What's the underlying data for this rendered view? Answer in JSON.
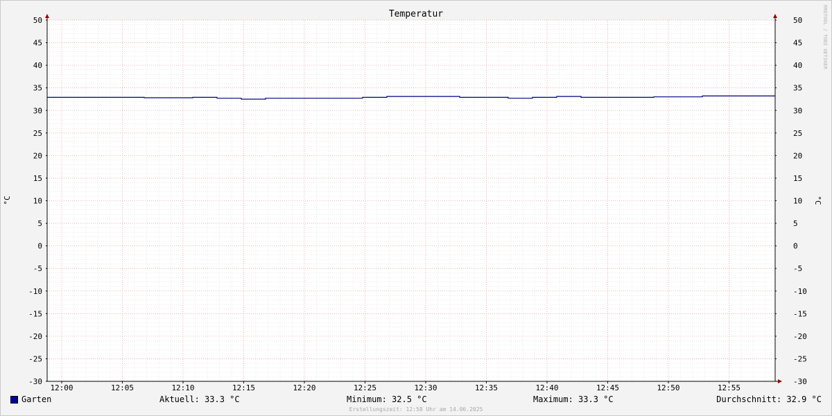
{
  "chart_data": {
    "type": "line",
    "title": "Temperatur",
    "ylabel": "°C",
    "ylabel_right": "°C",
    "ylim": [
      -30,
      50
    ],
    "y_ticks": [
      50,
      45,
      40,
      35,
      30,
      25,
      20,
      15,
      10,
      5,
      0,
      -5,
      -10,
      -15,
      -20,
      -25,
      -30
    ],
    "x_tick_labels": [
      "12:00",
      "12:05",
      "12:10",
      "12:15",
      "12:20",
      "12:25",
      "12:30",
      "12:35",
      "12:40",
      "12:45",
      "12:50",
      "12:55"
    ],
    "x_tick_minutes": [
      0,
      5,
      10,
      15,
      20,
      25,
      30,
      35,
      40,
      45,
      50,
      55
    ],
    "x_range_minutes": [
      -1.2,
      58.8
    ],
    "grid": true,
    "series": [
      {
        "name": "Garten",
        "color": "#000080",
        "step": true,
        "x_minutes": [
          -1.2,
          6.8,
          10.8,
          12.8,
          14.8,
          16.8,
          24.8,
          26.8,
          32.8,
          36.8,
          38.8,
          40.8,
          42.8,
          48.8,
          52.8,
          58.8
        ],
        "values": [
          32.9,
          32.8,
          32.9,
          32.7,
          32.5,
          32.7,
          32.9,
          33.1,
          32.9,
          32.7,
          32.9,
          33.1,
          32.9,
          33.0,
          33.2,
          33.2
        ]
      }
    ]
  },
  "legend": {
    "series_name": "Garten",
    "swatch_color": "#0000a0",
    "current": "Aktuell: 33.3 °C",
    "minimum": "Minimum: 32.5 °C",
    "maximum": "Maximum: 33.3 °C",
    "average": "Durchschnitt: 32.9 °C"
  },
  "watermark": "RRDTOOL / TOBI OETIKER",
  "footer": "Erstellungszeit: 12:58 Uhr am 14.06.2025"
}
